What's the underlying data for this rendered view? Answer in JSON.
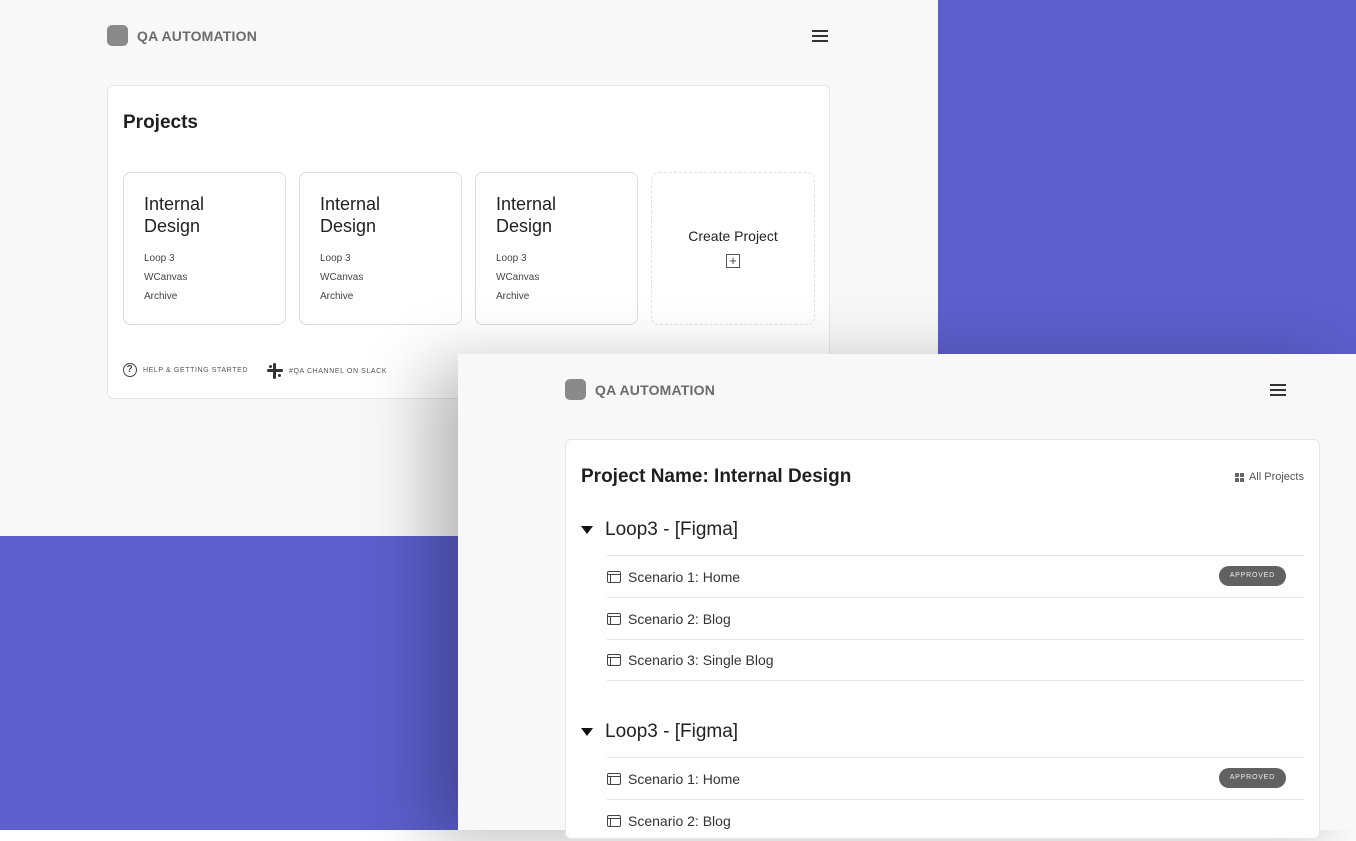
{
  "brand": {
    "name": "QA AUTOMATION"
  },
  "projects_page": {
    "title": "Projects",
    "cards": [
      {
        "title": "Internal Design",
        "items": [
          "Loop 3",
          "WCanvas",
          "Archive"
        ]
      },
      {
        "title": "Internal Design",
        "items": [
          "Loop 3",
          "WCanvas",
          "Archive"
        ]
      },
      {
        "title": "Internal Design",
        "items": [
          "Loop 3",
          "WCanvas",
          "Archive"
        ]
      }
    ],
    "create_label": "Create Project",
    "footer": {
      "help": "HELP & GETTING STARTED",
      "slack": "#QA CHANNEL ON SLACK"
    }
  },
  "project_page": {
    "title": "Project Name: Internal Design",
    "all_projects": "All Projects",
    "groups": [
      {
        "title": "Loop3 - [Figma]",
        "rows": [
          {
            "label": "Scenario 1: Home",
            "badge": "APPROVED"
          },
          {
            "label": "Scenario 2: Blog"
          },
          {
            "label": "Scenario 3: Single Blog"
          }
        ]
      },
      {
        "title": "Loop3 - [Figma]",
        "rows": [
          {
            "label": "Scenario 1: Home",
            "badge": "APPROVED"
          },
          {
            "label": "Scenario 2: Blog"
          }
        ]
      }
    ]
  },
  "colors": {
    "accent": "#5c5fcc",
    "badge": "#616161"
  }
}
